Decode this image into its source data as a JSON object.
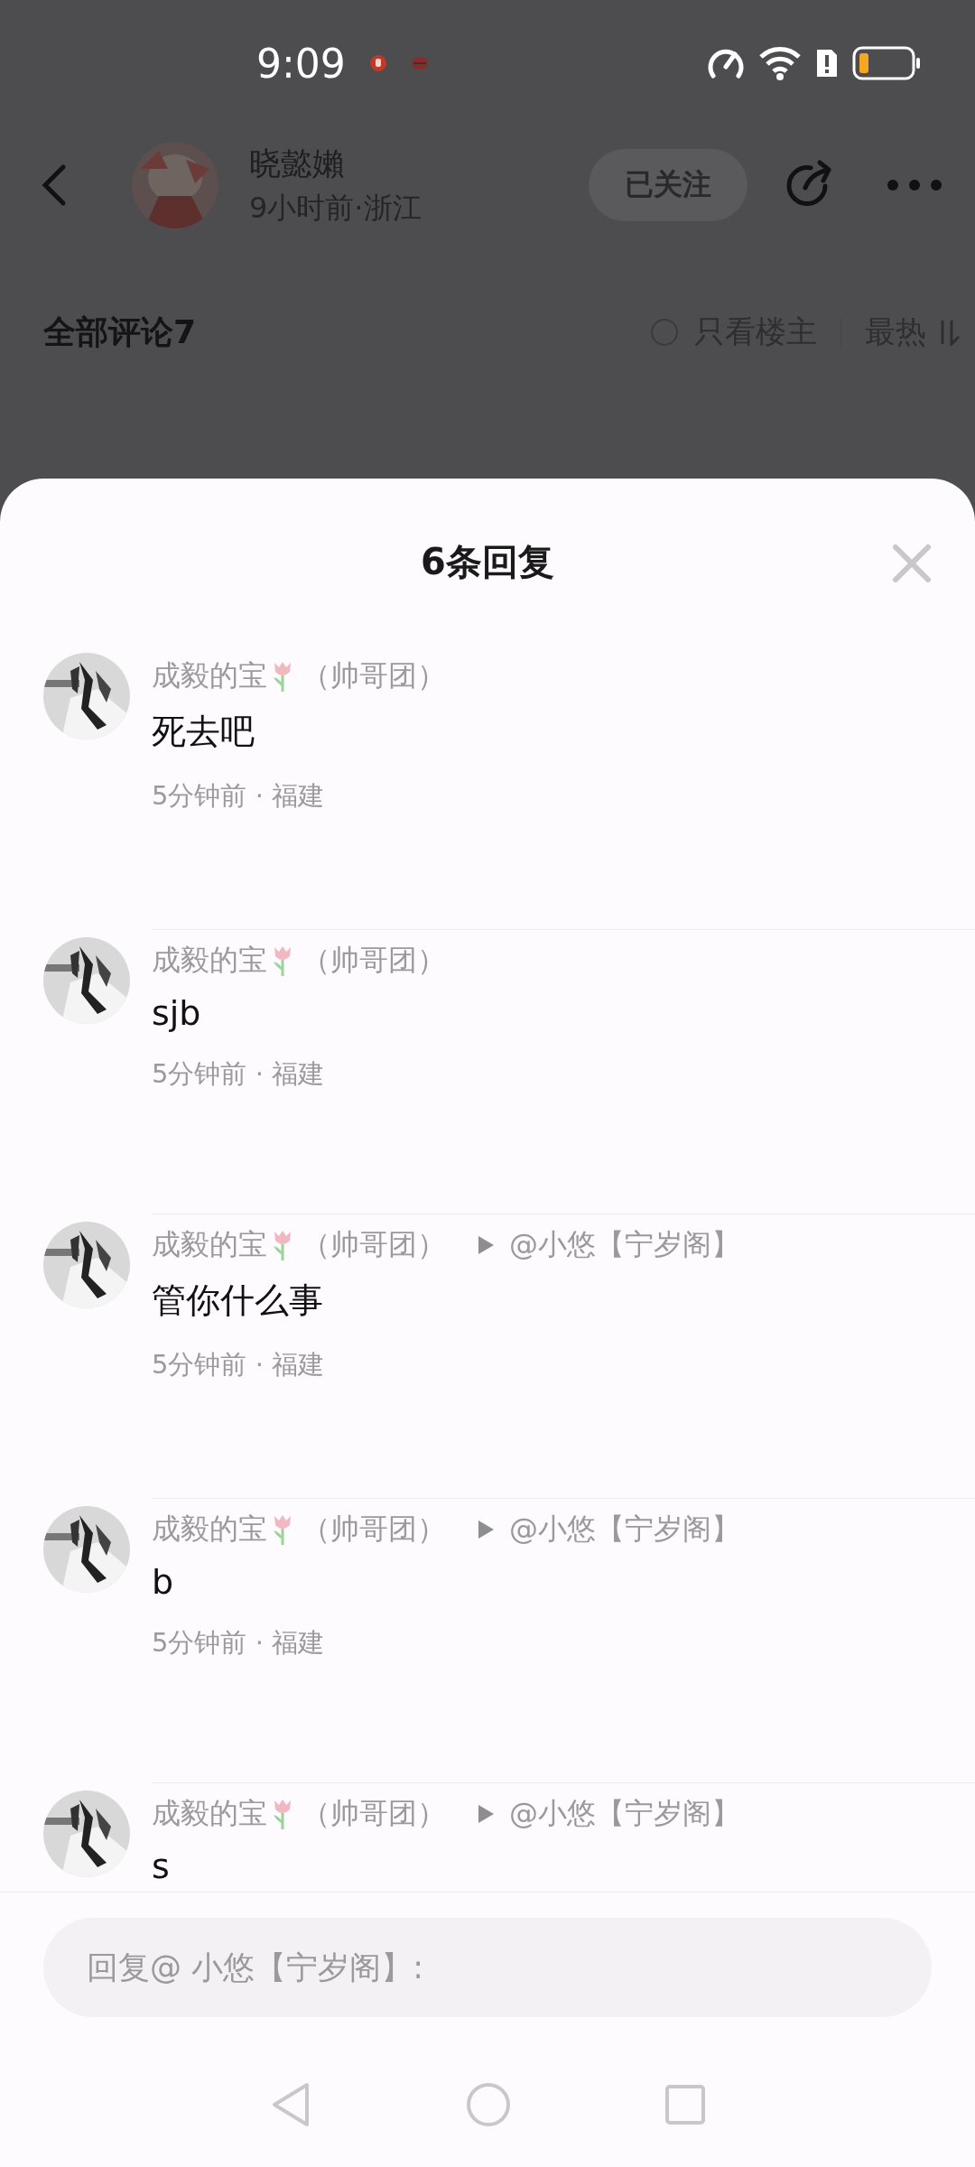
{
  "status_bar": {
    "time": "9:09"
  },
  "post_header": {
    "author": "晓懿嬾",
    "meta": "9小时前·浙江",
    "follow_button": "已关注"
  },
  "comments_header": {
    "title": "全部评论7",
    "filter": {
      "label": "只看楼主",
      "checked": false
    },
    "sort": "最热"
  },
  "reply_sheet": {
    "title": "6条回复",
    "replies": [
      {
        "name": "成毅的宝",
        "group": "（帅哥团）",
        "content": "死去吧",
        "meta": "5分钟前 · 福建"
      },
      {
        "name": "成毅的宝",
        "group": "（帅哥团）",
        "content": "sjb",
        "meta": "5分钟前 · 福建"
      },
      {
        "name": "成毅的宝",
        "group": "（帅哥团）",
        "reply_to": "@小悠【宁岁阁】",
        "content": "管你什么事",
        "meta": "5分钟前 · 福建"
      },
      {
        "name": "成毅的宝",
        "group": "（帅哥团）",
        "reply_to": "@小悠【宁岁阁】",
        "content": "b",
        "meta": "5分钟前 · 福建"
      },
      {
        "name": "成毅的宝",
        "group": "（帅哥团）",
        "reply_to": "@小悠【宁岁阁】",
        "content": "s"
      }
    ],
    "reply_input": {
      "placeholder": "回复@ 小悠【宁岁阁】:"
    }
  }
}
